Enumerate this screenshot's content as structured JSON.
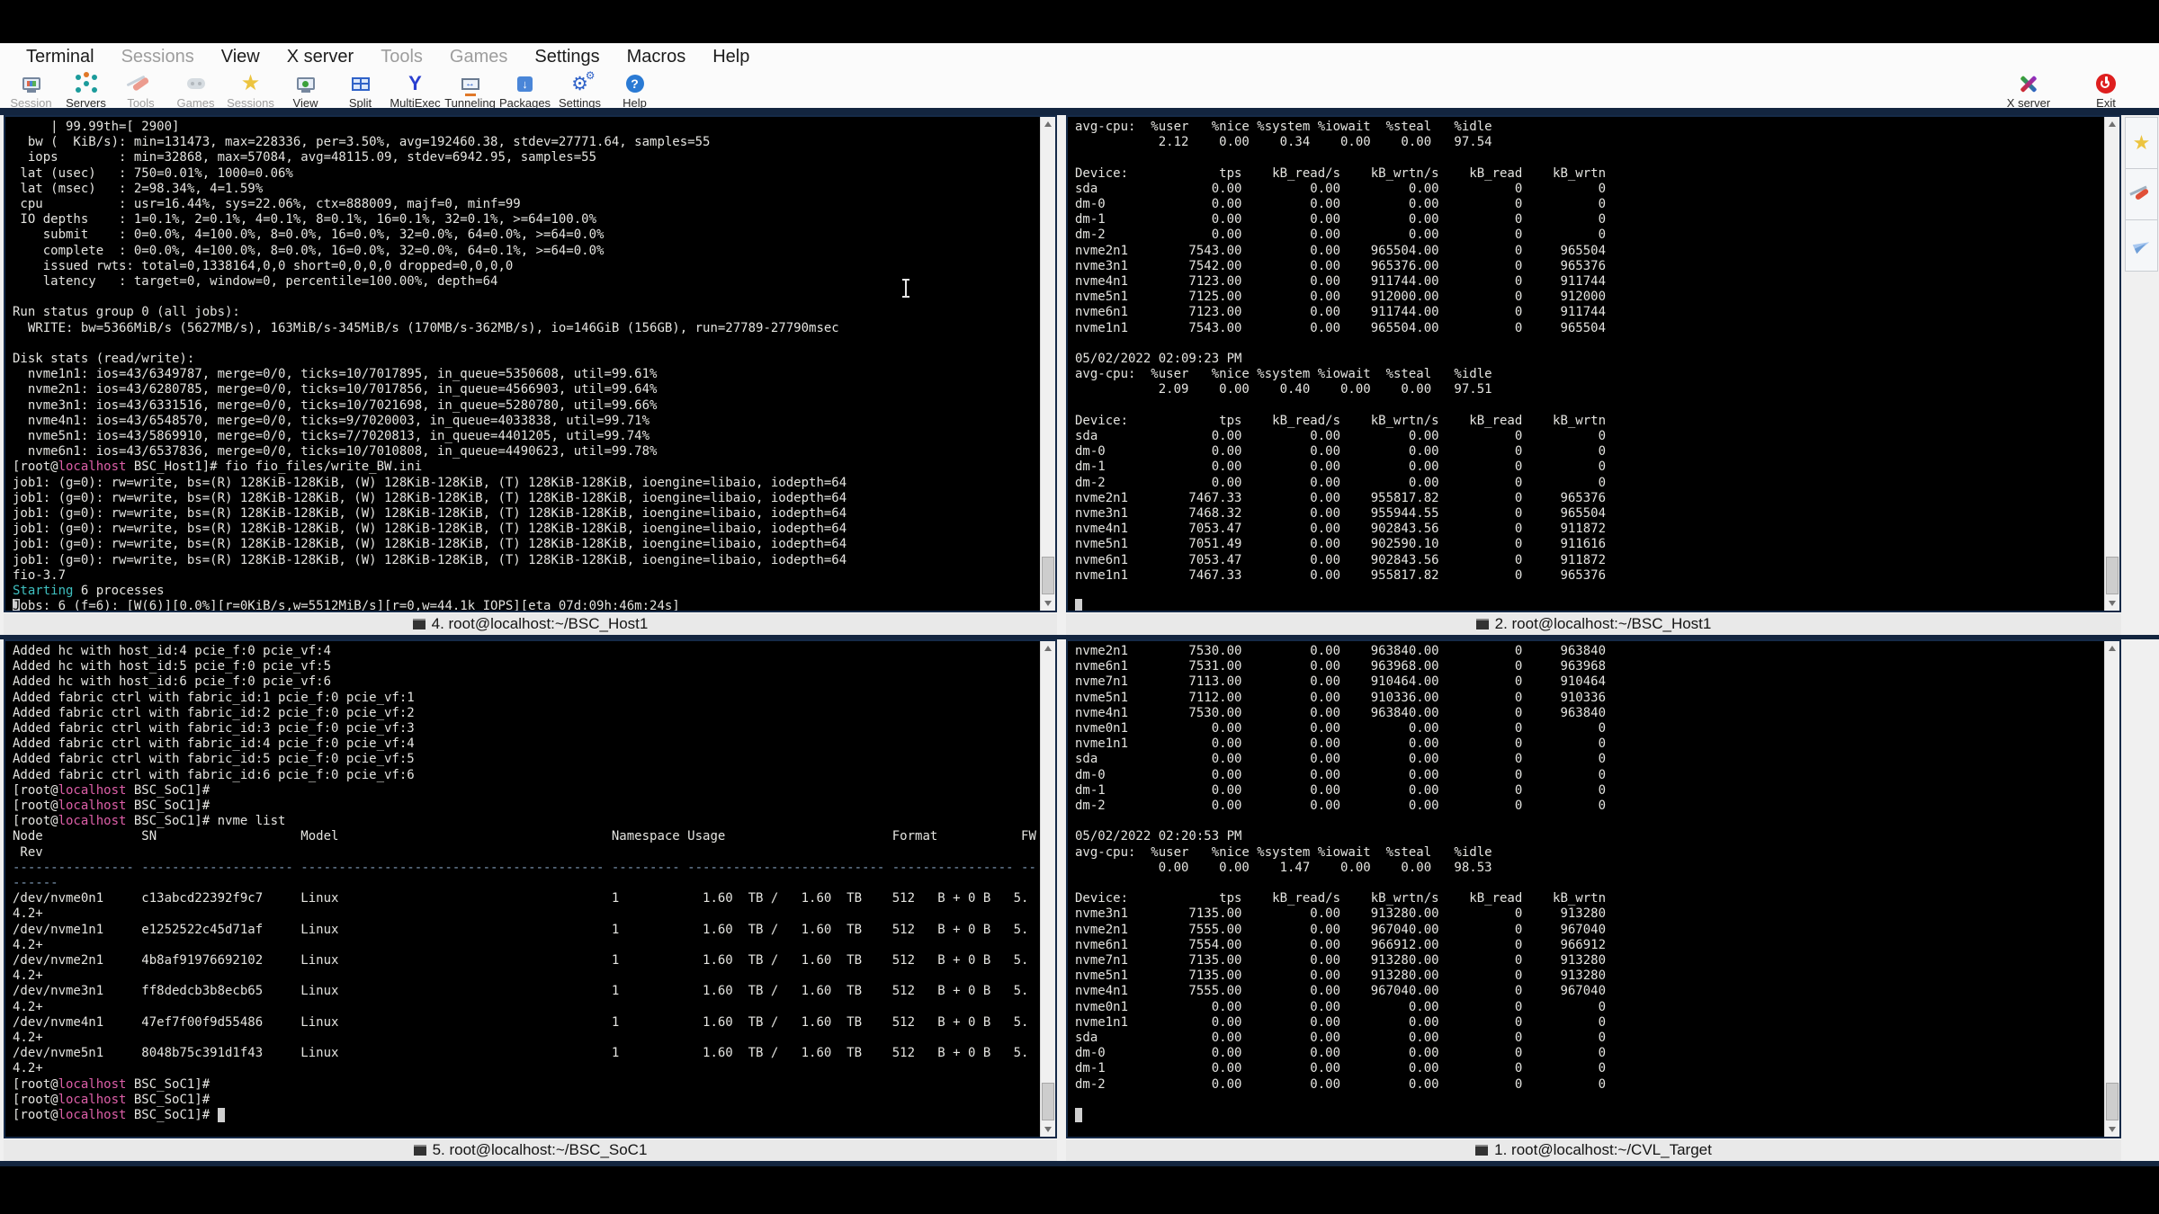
{
  "app": {
    "menu": {
      "items": [
        {
          "label": "Terminal",
          "enabled": true
        },
        {
          "label": "Sessions",
          "enabled": false
        },
        {
          "label": "View",
          "enabled": true
        },
        {
          "label": "X server",
          "enabled": true
        },
        {
          "label": "Tools",
          "enabled": false
        },
        {
          "label": "Games",
          "enabled": false
        },
        {
          "label": "Settings",
          "enabled": true
        },
        {
          "label": "Macros",
          "enabled": true
        },
        {
          "label": "Help",
          "enabled": true
        }
      ]
    },
    "toolbar": {
      "items": [
        {
          "label": "Session",
          "icon": "session-monitor-icon",
          "enabled": false
        },
        {
          "label": "Servers",
          "icon": "servers-nodes-icon",
          "enabled": true
        },
        {
          "label": "Tools",
          "icon": "swiss-knife-icon",
          "enabled": false
        },
        {
          "label": "Games",
          "icon": "gamepad-icon",
          "enabled": false
        },
        {
          "label": "Sessions",
          "icon": "star-icon",
          "enabled": false
        },
        {
          "label": "View",
          "icon": "monitor-user-icon",
          "enabled": true
        },
        {
          "label": "Split",
          "icon": "split-window-icon",
          "enabled": true
        },
        {
          "label": "MultiExec",
          "icon": "fork-icon",
          "enabled": true
        },
        {
          "label": "Tunneling",
          "icon": "tunnel-monitor-icon",
          "enabled": true
        },
        {
          "label": "Packages",
          "icon": "package-box-icon",
          "enabled": true
        },
        {
          "label": "Settings",
          "icon": "gears-icon",
          "enabled": true
        },
        {
          "label": "Help",
          "icon": "help-circle-icon",
          "enabled": true
        }
      ],
      "right": [
        {
          "label": "X server",
          "icon": "x-server-icon"
        },
        {
          "label": "Exit",
          "icon": "power-exit-icon"
        }
      ]
    }
  },
  "glyphs": {
    "star": "★",
    "gear": "⚙",
    "question": "?",
    "down_arrow": "↓",
    "lr_arrow": "↔",
    "fork": "Y"
  },
  "colors": {
    "terminal_bg": "#000000",
    "terminal_fg": "#e4e4e0",
    "prompt_host_magenta": "#dd5fa8",
    "starting_cyan": "#3fc0c0",
    "pane_border_navy": "#152a48",
    "exit_red": "#de1f1f"
  },
  "side_buttons": [
    {
      "name": "favorites-star"
    },
    {
      "name": "tools-knife"
    },
    {
      "name": "send-plane"
    }
  ],
  "panes": {
    "tl": {
      "title": "4. root@localhost:~/BSC_Host1",
      "lines": [
        "     | 99.99th=[ 2900]",
        "  bw (  KiB/s): min=131473, max=228336, per=3.50%, avg=192460.38, stdev=27771.64, samples=55",
        "  iops        : min=32868, max=57084, avg=48115.09, stdev=6942.95, samples=55",
        " lat (usec)   : 750=0.01%, 1000=0.06%",
        " lat (msec)   : 2=98.34%, 4=1.59%",
        " cpu          : usr=16.44%, sys=22.06%, ctx=888009, majf=0, minf=99",
        " IO depths    : 1=0.1%, 2=0.1%, 4=0.1%, 8=0.1%, 16=0.1%, 32=0.1%, >=64=100.0%",
        "    submit    : 0=0.0%, 4=100.0%, 8=0.0%, 16=0.0%, 32=0.0%, 64=0.0%, >=64=0.0%",
        "    complete  : 0=0.0%, 4=100.0%, 8=0.0%, 16=0.0%, 32=0.0%, 64=0.1%, >=64=0.0%",
        "    issued rwts: total=0,1338164,0,0 short=0,0,0,0 dropped=0,0,0,0",
        "    latency   : target=0, window=0, percentile=100.00%, depth=64",
        "",
        "Run status group 0 (all jobs):",
        "  WRITE: bw=5366MiB/s (5627MB/s), 163MiB/s-345MiB/s (170MB/s-362MB/s), io=146GiB (156GB), run=27789-27790msec",
        "",
        "Disk stats (read/write):",
        "  nvme1n1: ios=43/6349787, merge=0/0, ticks=10/7017895, in_queue=5350608, util=99.61%",
        "  nvme2n1: ios=43/6280785, merge=0/0, ticks=10/7017856, in_queue=4566903, util=99.64%",
        "  nvme3n1: ios=43/6331516, merge=0/0, ticks=10/7021698, in_queue=5280780, util=99.66%",
        "  nvme4n1: ios=43/6548570, merge=0/0, ticks=9/7020003, in_queue=4033838, util=99.71%",
        "  nvme5n1: ios=43/5869910, merge=0/0, ticks=7/7020813, in_queue=4401205, util=99.74%",
        "  nvme6n1: ios=43/6537836, merge=0/0, ticks=10/7010808, in_queue=4490623, util=99.78%",
        [
          "[root@",
          {
            "t": "localhost",
            "c": "m"
          },
          " BSC_Host1]# fio fio_files/write_BW.ini"
        ],
        "job1: (g=0): rw=write, bs=(R) 128KiB-128KiB, (W) 128KiB-128KiB, (T) 128KiB-128KiB, ioengine=libaio, iodepth=64",
        "job1: (g=0): rw=write, bs=(R) 128KiB-128KiB, (W) 128KiB-128KiB, (T) 128KiB-128KiB, ioengine=libaio, iodepth=64",
        "job1: (g=0): rw=write, bs=(R) 128KiB-128KiB, (W) 128KiB-128KiB, (T) 128KiB-128KiB, ioengine=libaio, iodepth=64",
        "job1: (g=0): rw=write, bs=(R) 128KiB-128KiB, (W) 128KiB-128KiB, (T) 128KiB-128KiB, ioengine=libaio, iodepth=64",
        "job1: (g=0): rw=write, bs=(R) 128KiB-128KiB, (W) 128KiB-128KiB, (T) 128KiB-128KiB, ioengine=libaio, iodepth=64",
        "job1: (g=0): rw=write, bs=(R) 128KiB-128KiB, (W) 128KiB-128KiB, (T) 128KiB-128KiB, ioengine=libaio, iodepth=64",
        "fio-3.7",
        [
          {
            "t": "Starting",
            "c": "c"
          },
          " 6 processes"
        ],
        [
          {
            "t": "J",
            "c": "inv"
          },
          "obs: 6 (f=6): [W(6)][0.0%][r=0KiB/s,w=5512MiB/s][r=0,w=44.1k IOPS][eta 07d:09h:46m:24s]"
        ]
      ]
    },
    "tr": {
      "title": "2. root@localhost:~/BSC_Host1",
      "lines": [
        "avg-cpu:  %user   %nice %system %iowait  %steal   %idle",
        "           2.12    0.00    0.34    0.00    0.00   97.54",
        "",
        "Device:            tps    kB_read/s    kB_wrtn/s    kB_read    kB_wrtn",
        "sda               0.00         0.00         0.00          0          0",
        "dm-0              0.00         0.00         0.00          0          0",
        "dm-1              0.00         0.00         0.00          0          0",
        "dm-2              0.00         0.00         0.00          0          0",
        "nvme2n1        7543.00         0.00    965504.00          0     965504",
        "nvme3n1        7542.00         0.00    965376.00          0     965376",
        "nvme4n1        7123.00         0.00    911744.00          0     911744",
        "nvme5n1        7125.00         0.00    912000.00          0     912000",
        "nvme6n1        7123.00         0.00    911744.00          0     911744",
        "nvme1n1        7543.00         0.00    965504.00          0     965504",
        "",
        "05/02/2022 02:09:23 PM",
        "avg-cpu:  %user   %nice %system %iowait  %steal   %idle",
        "           2.09    0.00    0.40    0.00    0.00   97.51",
        "",
        "Device:            tps    kB_read/s    kB_wrtn/s    kB_read    kB_wrtn",
        "sda               0.00         0.00         0.00          0          0",
        "dm-0              0.00         0.00         0.00          0          0",
        "dm-1              0.00         0.00         0.00          0          0",
        "dm-2              0.00         0.00         0.00          0          0",
        "nvme2n1        7467.33         0.00    955817.82          0     965376",
        "nvme3n1        7468.32         0.00    955944.55          0     965504",
        "nvme4n1        7053.47         0.00    902843.56          0     911872",
        "nvme5n1        7051.49         0.00    902590.10          0     911616",
        "nvme6n1        7053.47         0.00    902843.56          0     911872",
        "nvme1n1        7467.33         0.00    955817.82          0     965376",
        "",
        [
          {
            "t": " ",
            "c": "inv"
          }
        ]
      ]
    },
    "bl": {
      "title": "5. root@localhost:~/BSC_SoC1",
      "lines": [
        "Added hc with host_id:4 pcie_f:0 pcie_vf:4",
        "Added hc with host_id:5 pcie_f:0 pcie_vf:5",
        "Added hc with host_id:6 pcie_f:0 pcie_vf:6",
        "Added fabric ctrl with fabric_id:1 pcie_f:0 pcie_vf:1",
        "Added fabric ctrl with fabric_id:2 pcie_f:0 pcie_vf:2",
        "Added fabric ctrl with fabric_id:3 pcie_f:0 pcie_vf:3",
        "Added fabric ctrl with fabric_id:4 pcie_f:0 pcie_vf:4",
        "Added fabric ctrl with fabric_id:5 pcie_f:0 pcie_vf:5",
        "Added fabric ctrl with fabric_id:6 pcie_f:0 pcie_vf:6",
        [
          "[root@",
          {
            "t": "localhost",
            "c": "m"
          },
          " BSC_SoC1]#"
        ],
        [
          "[root@",
          {
            "t": "localhost",
            "c": "m"
          },
          " BSC_SoC1]#"
        ],
        [
          "[root@",
          {
            "t": "localhost",
            "c": "m"
          },
          " BSC_SoC1]# nvme list"
        ],
        "Node             SN                   Model                                    Namespace Usage                      Format           FW",
        " Rev",
        [
          {
            "t": "---------------- -------------------- ---------------------------------------- --------- -------------------------- ---------------- --",
            "c": "d"
          }
        ],
        [
          {
            "t": "------",
            "c": "d"
          }
        ],
        "/dev/nvme0n1     c13abcd22392f9c7     Linux                                    1           1.60  TB /   1.60  TB    512   B + 0 B   5.",
        "4.2+",
        "/dev/nvme1n1     e1252522c45d71af     Linux                                    1           1.60  TB /   1.60  TB    512   B + 0 B   5.",
        "4.2+",
        "/dev/nvme2n1     4b8af91976692102     Linux                                    1           1.60  TB /   1.60  TB    512   B + 0 B   5.",
        "4.2+",
        "/dev/nvme3n1     ff8dedcb3b8ecb65     Linux                                    1           1.60  TB /   1.60  TB    512   B + 0 B   5.",
        "4.2+",
        "/dev/nvme4n1     47ef7f00f9d55486     Linux                                    1           1.60  TB /   1.60  TB    512   B + 0 B   5.",
        "4.2+",
        "/dev/nvme5n1     8048b75c391d1f43     Linux                                    1           1.60  TB /   1.60  TB    512   B + 0 B   5.",
        "4.2+",
        [
          "[root@",
          {
            "t": "localhost",
            "c": "m"
          },
          " BSC_SoC1]#"
        ],
        [
          "[root@",
          {
            "t": "localhost",
            "c": "m"
          },
          " BSC_SoC1]#"
        ],
        [
          "[root@",
          {
            "t": "localhost",
            "c": "m"
          },
          " BSC_SoC1]# ",
          {
            "t": " ",
            "c": "inv"
          }
        ]
      ]
    },
    "br": {
      "title": "1. root@localhost:~/CVL_Target",
      "lines": [
        "nvme2n1        7530.00         0.00    963840.00          0     963840",
        "nvme6n1        7531.00         0.00    963968.00          0     963968",
        "nvme7n1        7113.00         0.00    910464.00          0     910464",
        "nvme5n1        7112.00         0.00    910336.00          0     910336",
        "nvme4n1        7530.00         0.00    963840.00          0     963840",
        "nvme0n1           0.00         0.00         0.00          0          0",
        "nvme1n1           0.00         0.00         0.00          0          0",
        "sda               0.00         0.00         0.00          0          0",
        "dm-0              0.00         0.00         0.00          0          0",
        "dm-1              0.00         0.00         0.00          0          0",
        "dm-2              0.00         0.00         0.00          0          0",
        "",
        "05/02/2022 02:20:53 PM",
        "avg-cpu:  %user   %nice %system %iowait  %steal   %idle",
        "           0.00    0.00    1.47    0.00    0.00   98.53",
        "",
        "Device:            tps    kB_read/s    kB_wrtn/s    kB_read    kB_wrtn",
        "nvme3n1        7135.00         0.00    913280.00          0     913280",
        "nvme2n1        7555.00         0.00    967040.00          0     967040",
        "nvme6n1        7554.00         0.00    966912.00          0     966912",
        "nvme7n1        7135.00         0.00    913280.00          0     913280",
        "nvme5n1        7135.00         0.00    913280.00          0     913280",
        "nvme4n1        7555.00         0.00    967040.00          0     967040",
        "nvme0n1           0.00         0.00         0.00          0          0",
        "nvme1n1           0.00         0.00         0.00          0          0",
        "sda               0.00         0.00         0.00          0          0",
        "dm-0              0.00         0.00         0.00          0          0",
        "dm-1              0.00         0.00         0.00          0          0",
        "dm-2              0.00         0.00         0.00          0          0",
        "",
        [
          {
            "t": " ",
            "c": "inv"
          }
        ]
      ]
    }
  }
}
